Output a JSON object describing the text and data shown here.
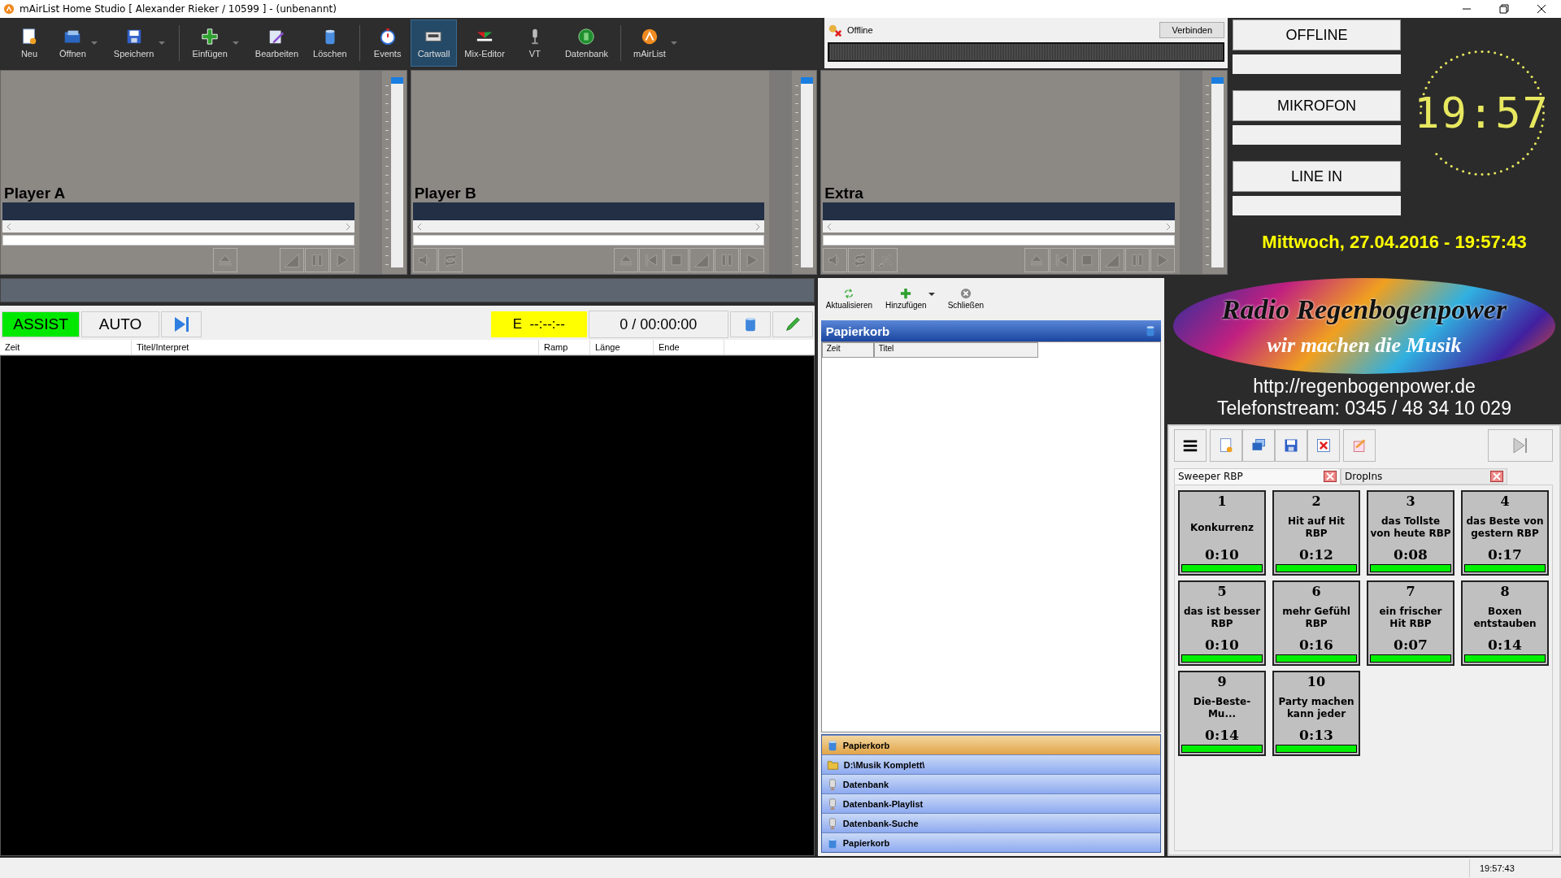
{
  "window": {
    "title": "mAirList Home Studio [ Alexander Rieker / 10599 ] - (unbenannt)"
  },
  "toolbar": {
    "groups": [
      [
        {
          "label": "Neu",
          "dropdown": false,
          "selected": false
        },
        {
          "label": "Öffnen",
          "dropdown": true,
          "selected": false
        },
        {
          "label": "Speichern",
          "dropdown": true,
          "selected": false
        }
      ],
      [
        {
          "label": "Einfügen",
          "dropdown": true,
          "selected": false
        },
        {
          "label": "Bearbeiten",
          "dropdown": false,
          "selected": false
        },
        {
          "label": "Löschen",
          "dropdown": false,
          "selected": false
        }
      ],
      [
        {
          "label": "Events",
          "dropdown": false,
          "selected": false
        },
        {
          "label": "Cartwall",
          "dropdown": false,
          "selected": true
        },
        {
          "label": "Mix-Editor",
          "dropdown": false,
          "selected": false
        },
        {
          "label": "VT",
          "dropdown": false,
          "selected": false
        },
        {
          "label": "Datenbank",
          "dropdown": false,
          "selected": false
        }
      ],
      [
        {
          "label": "mAirList",
          "dropdown": true,
          "selected": false
        }
      ]
    ]
  },
  "encoder": {
    "status": "Offline",
    "button": "Verbinden"
  },
  "players": [
    {
      "name": "Player A",
      "level": 1,
      "controls": [
        {
          "kind": "eject"
        },
        {
          "kind": "gap"
        },
        {
          "kind": "fade"
        },
        {
          "kind": "pause"
        },
        {
          "kind": "play"
        }
      ]
    },
    {
      "name": "Player B",
      "level": 1,
      "left_controls": [
        {
          "kind": "volume"
        },
        {
          "kind": "loop"
        }
      ],
      "controls": [
        {
          "kind": "eject"
        },
        {
          "kind": "prev"
        },
        {
          "kind": "stop"
        },
        {
          "kind": "fade"
        },
        {
          "kind": "pause"
        },
        {
          "kind": "play"
        }
      ]
    },
    {
      "name": "Extra",
      "level": 1,
      "left_controls": [
        {
          "kind": "volume"
        },
        {
          "kind": "loop"
        },
        {
          "kind": "cut"
        }
      ],
      "controls": [
        {
          "kind": "eject"
        },
        {
          "kind": "prev"
        },
        {
          "kind": "stop"
        },
        {
          "kind": "fade"
        },
        {
          "kind": "pause"
        },
        {
          "kind": "play"
        }
      ]
    }
  ],
  "studio_buttons": [
    {
      "label": "OFFLINE"
    },
    {
      "label": "MIKROFON"
    },
    {
      "label": "LINE IN"
    }
  ],
  "clock": "19:57",
  "date": "Mittwoch, 27.04.2016 - 19:57:43",
  "playlist": {
    "modes": [
      {
        "label": "ASSIST",
        "selected": true
      },
      {
        "label": "AUTO",
        "selected": false
      }
    ],
    "end_time": "E  --:--:--",
    "count": "0 / 00:00:00",
    "columns": [
      "Zeit",
      "Titel/Interpret",
      "Ramp",
      "Länge",
      "Ende"
    ]
  },
  "browser": {
    "actions": [
      {
        "label": "Aktualisieren",
        "dropdown": false
      },
      {
        "label": "Hinzufügen",
        "dropdown": true
      },
      {
        "label": "Schließen",
        "dropdown": false
      }
    ],
    "title": "Papierkorb",
    "columns": [
      "Zeit",
      "Titel"
    ],
    "sources": [
      {
        "label": "Papierkorb",
        "kind": "trash",
        "selected": true
      },
      {
        "label": "D:\\Musik Komplett\\",
        "kind": "folder",
        "selected": false
      },
      {
        "label": "Datenbank",
        "kind": "database",
        "selected": false
      },
      {
        "label": "Datenbank-Playlist",
        "kind": "database",
        "selected": false
      },
      {
        "label": "Datenbank-Suche",
        "kind": "database",
        "selected": false
      },
      {
        "label": "Papierkorb",
        "kind": "trash",
        "selected": false
      }
    ]
  },
  "logo": {
    "title": "Radio Regenbogenpower",
    "slogan": "wir machen die Musik"
  },
  "url": "http://regenbogenpower.de",
  "phone": "Telefonstream: 0345 / 48 34 10 029",
  "cartwall": {
    "tabs": [
      {
        "label": "Sweeper RBP",
        "selected": true
      },
      {
        "label": "DropIns",
        "selected": false
      }
    ],
    "carts": [
      {
        "number": "1",
        "title": "Konkurrenz",
        "duration": "0:10",
        "level": 1
      },
      {
        "number": "2",
        "title": "Hit auf Hit RBP",
        "duration": "0:12",
        "level": 1
      },
      {
        "number": "3",
        "title": "das Tollste von heute RBP",
        "duration": "0:08",
        "level": 1
      },
      {
        "number": "4",
        "title": "das Beste von gestern RBP",
        "duration": "0:17",
        "level": 1
      },
      {
        "number": "5",
        "title": "das ist besser RBP",
        "duration": "0:10",
        "level": 1
      },
      {
        "number": "6",
        "title": "mehr Gefühl RBP",
        "duration": "0:16",
        "level": 1
      },
      {
        "number": "7",
        "title": "ein frischer Hit RBP",
        "duration": "0:07",
        "level": 1
      },
      {
        "number": "8",
        "title": "Boxen entstauben",
        "duration": "0:14",
        "level": 1
      },
      {
        "number": "9",
        "title": "Die-Beste-Mu...",
        "duration": "0:14",
        "level": 1
      },
      {
        "number": "10",
        "title": "Party machen kann jeder",
        "duration": "0:13",
        "level": 1
      }
    ]
  },
  "status_bar": {
    "time": "19:57:43"
  }
}
